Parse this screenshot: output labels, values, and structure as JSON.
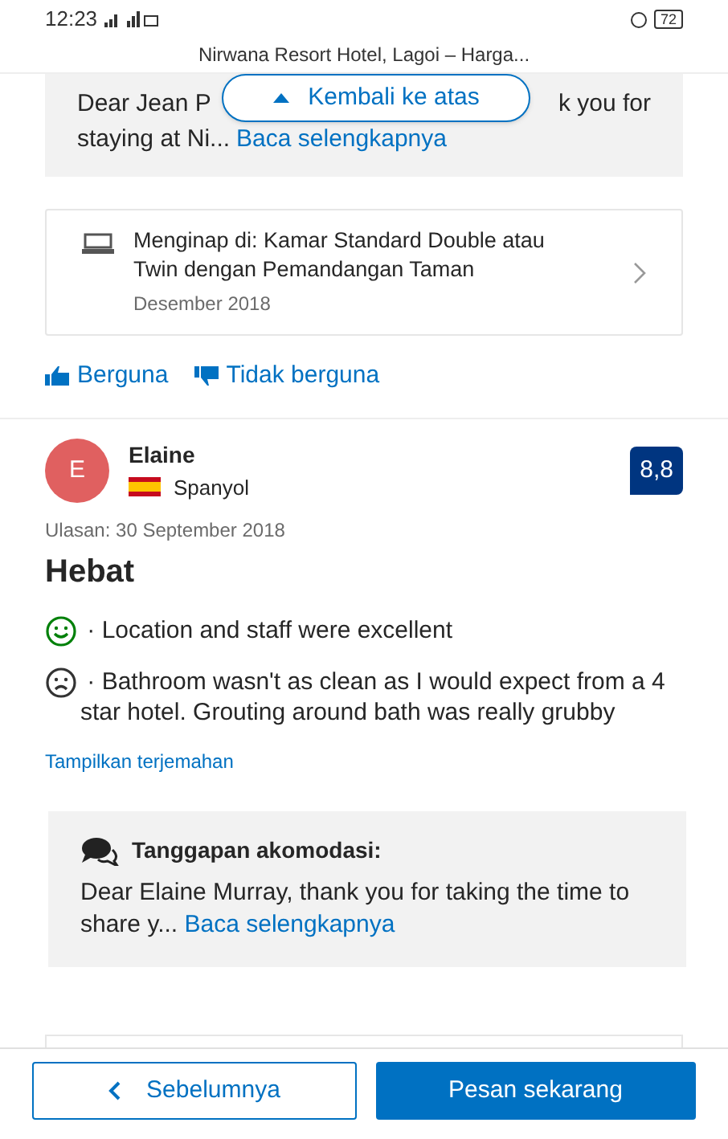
{
  "status_bar": {
    "time": "12:23",
    "battery": "72"
  },
  "header": {
    "title": "Nirwana Resort Hotel, Lagoi – Harga..."
  },
  "previous_response": {
    "line_1_left": "Dear Jean P",
    "line_1_right": "k you for",
    "line_2": "staying at Ni...",
    "link": "Baca selengkapnya"
  },
  "back_to_top": {
    "label": "Kembali ke atas"
  },
  "stay_card": {
    "room": "Menginap di: Kamar Standard Double atau Twin dengan Pemandangan Taman",
    "date": "Desember 2018"
  },
  "feedback": [
    {
      "kind": "up",
      "label": "Berguna"
    },
    {
      "kind": "down",
      "label": "Tidak berguna"
    }
  ],
  "review": {
    "initial": "E",
    "name": "Elaine",
    "country": "Spanyol",
    "score": "8,8",
    "date": "Ulasan: 30 September 2018",
    "title": "Hebat",
    "points": [
      {
        "kind": "positive",
        "text": "· Location and staff were excellent"
      },
      {
        "kind": "negative",
        "text": "· Bathroom wasn't as clean as I would expect from a 4 star hotel. Grouting around bath was really grubby"
      }
    ],
    "translate": "Tampilkan terjemahan",
    "response": {
      "heading": "Tanggapan akomodasi:",
      "text": "Dear Elaine Murray, thank you for taking the time to share y...",
      "link": "Baca selengkapnya"
    }
  },
  "buttons": [
    {
      "kind": "secondary",
      "label": "Sebelumnya"
    },
    {
      "kind": "primary",
      "label": "Pesan sekarang"
    }
  ]
}
